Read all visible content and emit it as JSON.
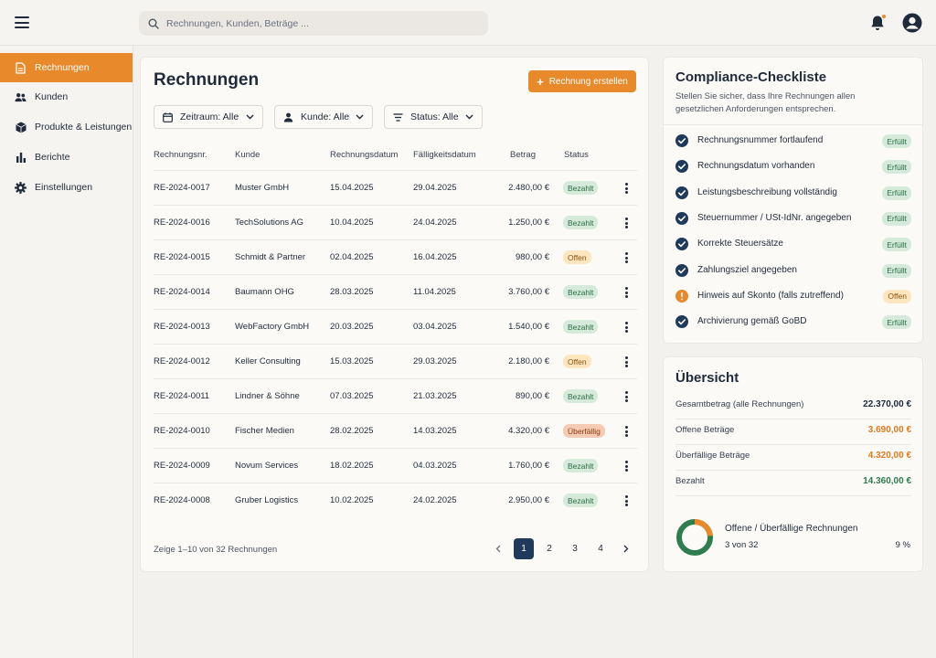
{
  "search": {
    "placeholder": "Rechnungen, Kunden, Beträge ..."
  },
  "sidebar": {
    "items": [
      {
        "label": "Rechnungen",
        "icon": "document-icon",
        "active": true
      },
      {
        "label": "Kunden",
        "icon": "users-icon"
      },
      {
        "label": "Produkte & Leistungen",
        "icon": "box-icon"
      },
      {
        "label": "Berichte",
        "icon": "bar-chart-icon"
      },
      {
        "label": "Einstellungen",
        "icon": "gear-icon"
      }
    ]
  },
  "main": {
    "title": "Rechnungen",
    "create_label": "Rechnung erstellen",
    "filters": {
      "period": "Zeitraum: Alle",
      "customer": "Kunde: Alle",
      "status": "Status: Alle"
    },
    "columns": {
      "number": "Rechnungsnr.",
      "customer": "Kunde",
      "date": "Rechnungsdatum",
      "due": "Fälligkeitsdatum",
      "amount": "Betrag",
      "status": "Status"
    },
    "rows": [
      {
        "number": "RE-2024-0017",
        "customer": "Muster GmbH",
        "date": "15.04.2025",
        "due": "29.04.2025",
        "amount": "2.480,00 €",
        "status": "Bezahlt",
        "status_type": "paid"
      },
      {
        "number": "RE-2024-0016",
        "customer": "TechSolutions AG",
        "date": "10.04.2025",
        "due": "24.04.2025",
        "amount": "1.250,00 €",
        "status": "Bezahlt",
        "status_type": "paid"
      },
      {
        "number": "RE-2024-0015",
        "customer": "Schmidt & Partner",
        "date": "02.04.2025",
        "due": "16.04.2025",
        "amount": "980,00 €",
        "status": "Offen",
        "status_type": "open"
      },
      {
        "number": "RE-2024-0014",
        "customer": "Baumann OHG",
        "date": "28.03.2025",
        "due": "11.04.2025",
        "amount": "3.760,00 €",
        "status": "Bezahlt",
        "status_type": "paid"
      },
      {
        "number": "RE-2024-0013",
        "customer": "WebFactory GmbH",
        "date": "20.03.2025",
        "due": "03.04.2025",
        "amount": "1.540,00 €",
        "status": "Bezahlt",
        "status_type": "paid"
      },
      {
        "number": "RE-2024-0012",
        "customer": "Keller Consulting",
        "date": "15.03.2025",
        "due": "29.03.2025",
        "amount": "2.180,00 €",
        "status": "Offen",
        "status_type": "open"
      },
      {
        "number": "RE-2024-0011",
        "customer": "Lindner & Söhne",
        "date": "07.03.2025",
        "due": "21.03.2025",
        "amount": "890,00 €",
        "status": "Bezahlt",
        "status_type": "paid"
      },
      {
        "number": "RE-2024-0010",
        "customer": "Fischer Medien",
        "date": "28.02.2025",
        "due": "14.03.2025",
        "amount": "4.320,00 €",
        "status": "Überfällig",
        "status_type": "overdue"
      },
      {
        "number": "RE-2024-0009",
        "customer": "Novum Services",
        "date": "18.02.2025",
        "due": "04.03.2025",
        "amount": "1.760,00 €",
        "status": "Bezahlt",
        "status_type": "paid"
      },
      {
        "number": "RE-2024-0008",
        "customer": "Gruber Logistics",
        "date": "10.02.2025",
        "due": "24.02.2025",
        "amount": "2.950,00 €",
        "status": "Bezahlt",
        "status_type": "paid"
      }
    ],
    "pager": {
      "info": "Zeige 1–10 von 32 Rechnungen",
      "pages": [
        "1",
        "2",
        "3",
        "4"
      ],
      "current": "1"
    }
  },
  "checklist": {
    "title": "Compliance-Checkliste",
    "subtitle": "Stellen Sie sicher, dass Ihre Rechnungen allen gesetzlichen Anforderungen entsprechen.",
    "items": [
      {
        "label": "Rechnungsnummer fortlaufend",
        "status": "Erfüllt",
        "state": "ok"
      },
      {
        "label": "Rechnungsdatum vorhanden",
        "status": "Erfüllt",
        "state": "ok"
      },
      {
        "label": "Leistungsbeschreibung vollständig",
        "status": "Erfüllt",
        "state": "ok"
      },
      {
        "label": "Steuernummer / USt-IdNr. angegeben",
        "status": "Erfüllt",
        "state": "ok"
      },
      {
        "label": "Korrekte Steuersätze",
        "status": "Erfüllt",
        "state": "ok"
      },
      {
        "label": "Zahlungsziel angegeben",
        "status": "Erfüllt",
        "state": "ok"
      },
      {
        "label": "Hinweis auf Skonto (falls zutreffend)",
        "status": "Offen",
        "state": "warn"
      },
      {
        "label": "Archivierung gemäß GoBD",
        "status": "Erfüllt",
        "state": "ok"
      }
    ]
  },
  "overview": {
    "title": "Übersicht",
    "rows": [
      {
        "label": "Gesamtbetrag (alle Rechnungen)",
        "value": "22.370,00 €",
        "color": "#1f2a3a"
      },
      {
        "label": "Offene Beträge",
        "value": "3.690,00 €",
        "color": "#e07a1f"
      },
      {
        "label": "Überfällige Beträge",
        "value": "4.320,00 €",
        "color": "#e07a1f"
      },
      {
        "label": "Bezahlt",
        "value": "14.360,00 €",
        "color": "#2f7d4f"
      }
    ],
    "donut_label": "Offene / Überfällige Rechnungen",
    "donut_count": "3 von 32",
    "donut_percent": "9 %",
    "donut_fraction": 0.09
  },
  "colors": {
    "accent": "#e8892b",
    "navy": "#1f3a5a",
    "green": "#2f7d4f"
  }
}
